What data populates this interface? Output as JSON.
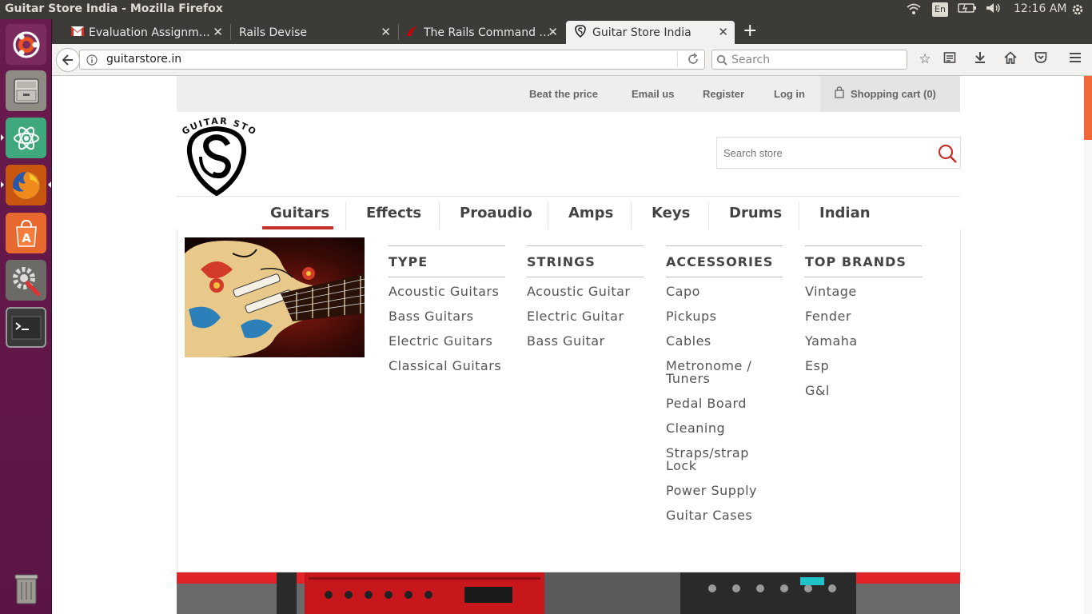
{
  "os": {
    "window_title": "Guitar Store India - Mozilla Firefox",
    "keyboard_layout": "En",
    "clock": "12:16 AM"
  },
  "browser": {
    "tabs": [
      {
        "label": "Evaluation Assignm…",
        "icon": "gmail-icon"
      },
      {
        "label": "Rails Devise",
        "icon": ""
      },
      {
        "label": "The Rails Command …",
        "icon": "rails-icon"
      },
      {
        "label": "Guitar Store India",
        "icon": "guitar-store-favicon",
        "active": true
      }
    ],
    "url": "guitarstore.in",
    "search_placeholder": "Search"
  },
  "site": {
    "logo_text": "GUITAR STORE",
    "header_links": {
      "beat_the_price": "Beat the price",
      "email_us": "Email us",
      "register": "Register",
      "log_in": "Log in",
      "cart": "Shopping cart (0)"
    },
    "search_placeholder": "Search store",
    "menu": [
      "Guitars",
      "Effects",
      "Proaudio",
      "Amps",
      "Keys",
      "Drums",
      "Indian"
    ],
    "active_menu": "Guitars",
    "columns": [
      {
        "heading": "TYPE",
        "items": [
          "Acoustic Guitars",
          "Bass Guitars",
          "Electric Guitars",
          "Classical Guitars"
        ]
      },
      {
        "heading": "STRINGS",
        "items": [
          "Acoustic Guitar",
          "Electric Guitar",
          "Bass Guitar"
        ]
      },
      {
        "heading": "ACCESSORIES",
        "items": [
          "Capo",
          "Pickups",
          "Cables",
          "Metronome / Tuners",
          "Pedal Board",
          "Cleaning",
          "Straps/strap Lock",
          "Power Supply",
          "Guitar Cases"
        ]
      },
      {
        "heading": "TOP BRANDS",
        "items": [
          "Vintage",
          "Fender",
          "Yamaha",
          "Esp",
          "G&l"
        ]
      }
    ]
  },
  "colors": {
    "accent": "#c6302b",
    "scroll_thumb": "#f26739",
    "launcher": "#5e1748",
    "panel": "#3c3b37"
  }
}
